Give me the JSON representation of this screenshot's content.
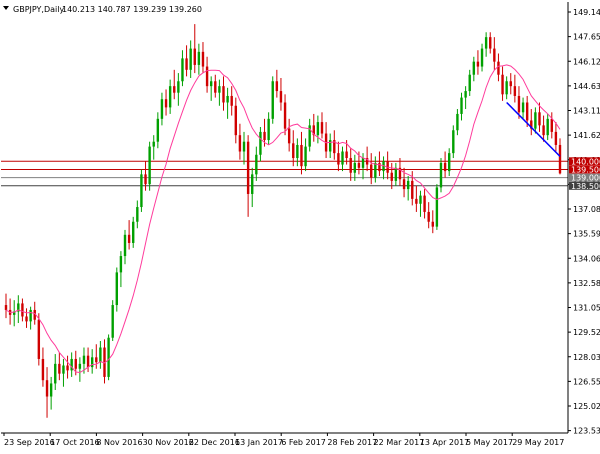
{
  "header": {
    "symbol_label": "GBPJPY,Daily",
    "ohlc_text": "140.213 140.787 139.239 139.260"
  },
  "colors": {
    "bull": "#00a000",
    "bear": "#d00000",
    "ma": "#ff3c9c",
    "trendline": "#0000ff",
    "level_red": "#c00000",
    "level_gray": "#808080",
    "level_dark": "#404040"
  },
  "chart_data": {
    "type": "candlestick",
    "title": "GBPJPY,Daily",
    "xlabel": "",
    "ylabel": "",
    "ylim": [
      124.2,
      149.7
    ],
    "grid": false,
    "y_ticks": [
      "149.140",
      "147.655",
      "146.125",
      "144.630",
      "143.110",
      "141.625",
      "140.095",
      "138.600",
      "137.080",
      "135.595",
      "134.065",
      "132.580",
      "131.050",
      "129.525",
      "128.035",
      "126.550",
      "125.020",
      "123.535"
    ],
    "x_ticks": [
      "23 Sep 2016",
      "17 Oct 2016",
      "8 Nov 2016",
      "30 Nov 2016",
      "22 Dec 2016",
      "13 Jan 2017",
      "6 Feb 2017",
      "28 Feb 2017",
      "22 Mar 2017",
      "13 Apr 2017",
      "5 May 2017",
      "29 May 2017"
    ],
    "levels": [
      {
        "label": "140.000",
        "value": 140.0,
        "color": "level_red"
      },
      {
        "label": "139.500",
        "value": 139.5,
        "color": "level_red"
      },
      {
        "label": "139.000",
        "value": 139.0,
        "color": "level_gray"
      },
      {
        "label": "138.500",
        "value": 138.5,
        "color": "level_dark"
      }
    ],
    "trendline": {
      "from": {
        "bar": 122,
        "price": 143.6
      },
      "to": {
        "bar": 135,
        "price": 140.3
      }
    },
    "ma_period": 10,
    "ohlc": [
      [
        131.2,
        131.9,
        130.4,
        130.9
      ],
      [
        130.9,
        131.6,
        130.0,
        130.6
      ],
      [
        130.6,
        131.5,
        129.9,
        130.8
      ],
      [
        130.8,
        131.8,
        130.1,
        131.3
      ],
      [
        131.3,
        131.6,
        130.2,
        130.5
      ],
      [
        130.5,
        131.0,
        129.8,
        130.2
      ],
      [
        130.2,
        131.1,
        129.7,
        130.9
      ],
      [
        130.9,
        131.4,
        130.0,
        130.3
      ],
      [
        130.3,
        130.7,
        127.5,
        127.9
      ],
      [
        127.9,
        128.6,
        126.2,
        126.6
      ],
      [
        126.6,
        127.4,
        124.3,
        125.6
      ],
      [
        125.6,
        126.8,
        124.8,
        126.4
      ],
      [
        126.4,
        128.2,
        126.0,
        127.6
      ],
      [
        127.6,
        128.3,
        126.6,
        127.0
      ],
      [
        127.0,
        127.9,
        126.2,
        127.5
      ],
      [
        127.5,
        128.1,
        126.7,
        127.2
      ],
      [
        127.2,
        128.3,
        126.8,
        127.9
      ],
      [
        127.9,
        128.4,
        126.9,
        127.3
      ],
      [
        127.3,
        128.0,
        126.5,
        127.6
      ],
      [
        127.6,
        128.6,
        127.0,
        128.1
      ],
      [
        128.1,
        128.6,
        127.1,
        127.4
      ],
      [
        127.4,
        128.5,
        127.0,
        128.0
      ],
      [
        128.0,
        128.8,
        127.3,
        127.7
      ],
      [
        127.7,
        129.0,
        127.3,
        128.6
      ],
      [
        128.6,
        129.1,
        126.4,
        126.8
      ],
      [
        126.8,
        129.4,
        126.6,
        129.2
      ],
      [
        129.2,
        131.5,
        129.0,
        131.2
      ],
      [
        131.2,
        133.5,
        130.8,
        133.2
      ],
      [
        133.2,
        134.5,
        132.3,
        134.2
      ],
      [
        134.2,
        135.8,
        133.7,
        135.5
      ],
      [
        135.5,
        136.4,
        134.6,
        135.0
      ],
      [
        135.0,
        136.6,
        134.7,
        136.3
      ],
      [
        136.3,
        137.6,
        135.9,
        137.2
      ],
      [
        137.2,
        139.5,
        136.9,
        139.2
      ],
      [
        139.2,
        140.0,
        138.2,
        138.6
      ],
      [
        138.6,
        141.2,
        138.2,
        140.9
      ],
      [
        140.9,
        141.6,
        140.1,
        141.2
      ],
      [
        141.2,
        143.0,
        140.8,
        142.6
      ],
      [
        142.6,
        144.2,
        142.2,
        143.8
      ],
      [
        143.8,
        144.4,
        142.8,
        143.3
      ],
      [
        143.3,
        145.0,
        142.9,
        144.6
      ],
      [
        144.6,
        145.6,
        143.8,
        144.2
      ],
      [
        144.2,
        145.4,
        143.4,
        144.9
      ],
      [
        144.9,
        146.8,
        144.6,
        146.3
      ],
      [
        146.3,
        147.1,
        145.2,
        145.6
      ],
      [
        145.6,
        147.4,
        145.1,
        146.9
      ],
      [
        146.9,
        148.4,
        145.4,
        145.9
      ],
      [
        145.9,
        147.2,
        145.3,
        146.7
      ],
      [
        146.7,
        147.3,
        145.4,
        145.8
      ],
      [
        145.8,
        146.4,
        144.2,
        144.6
      ],
      [
        144.6,
        145.2,
        143.7,
        144.9
      ],
      [
        144.9,
        145.3,
        143.9,
        144.2
      ],
      [
        144.2,
        145.0,
        143.4,
        144.6
      ],
      [
        144.6,
        145.2,
        143.1,
        143.6
      ],
      [
        143.6,
        144.5,
        142.6,
        144.0
      ],
      [
        144.0,
        144.6,
        142.8,
        143.4
      ],
      [
        143.4,
        143.9,
        141.1,
        141.6
      ],
      [
        141.6,
        142.3,
        140.1,
        140.6
      ],
      [
        140.6,
        141.8,
        139.8,
        141.2
      ],
      [
        141.2,
        141.6,
        136.6,
        138.0
      ],
      [
        138.0,
        139.6,
        137.2,
        139.2
      ],
      [
        139.2,
        140.9,
        138.8,
        140.4
      ],
      [
        140.4,
        142.1,
        140.0,
        141.8
      ],
      [
        141.8,
        142.6,
        140.9,
        141.3
      ],
      [
        141.3,
        143.0,
        141.0,
        142.6
      ],
      [
        142.6,
        145.2,
        142.3,
        144.9
      ],
      [
        144.9,
        145.6,
        143.9,
        144.3
      ],
      [
        144.3,
        145.1,
        143.1,
        143.6
      ],
      [
        143.6,
        144.1,
        141.6,
        142.0
      ],
      [
        142.0,
        142.6,
        140.6,
        141.1
      ],
      [
        141.1,
        141.9,
        139.7,
        140.2
      ],
      [
        140.2,
        141.4,
        139.7,
        141.0
      ],
      [
        141.0,
        141.8,
        139.2,
        139.7
      ],
      [
        139.7,
        141.4,
        139.4,
        140.9
      ],
      [
        140.9,
        142.6,
        140.6,
        142.2
      ],
      [
        142.2,
        142.9,
        141.2,
        141.6
      ],
      [
        141.6,
        142.8,
        141.1,
        142.4
      ],
      [
        142.4,
        143.0,
        141.4,
        141.7
      ],
      [
        141.7,
        142.4,
        140.2,
        140.6
      ],
      [
        140.6,
        141.7,
        140.2,
        141.3
      ],
      [
        141.3,
        141.9,
        140.1,
        140.5
      ],
      [
        140.5,
        141.2,
        139.4,
        139.8
      ],
      [
        139.8,
        140.9,
        139.4,
        140.6
      ],
      [
        140.6,
        141.3,
        139.8,
        140.2
      ],
      [
        140.2,
        140.8,
        138.8,
        139.3
      ],
      [
        139.3,
        140.4,
        138.8,
        139.9
      ],
      [
        139.9,
        140.6,
        139.2,
        139.6
      ],
      [
        139.6,
        140.5,
        138.9,
        140.2
      ],
      [
        140.2,
        140.9,
        139.4,
        139.8
      ],
      [
        139.8,
        140.5,
        138.6,
        139.0
      ],
      [
        139.0,
        140.3,
        138.7,
        139.9
      ],
      [
        139.9,
        140.6,
        139.1,
        139.4
      ],
      [
        139.4,
        140.3,
        138.9,
        140.0
      ],
      [
        140.0,
        140.6,
        138.9,
        139.3
      ],
      [
        139.3,
        139.9,
        138.3,
        138.8
      ],
      [
        138.8,
        139.9,
        138.5,
        139.6
      ],
      [
        139.6,
        140.2,
        138.5,
        138.9
      ],
      [
        138.9,
        139.6,
        137.8,
        138.3
      ],
      [
        138.3,
        139.1,
        137.6,
        138.8
      ],
      [
        138.8,
        139.4,
        137.3,
        137.7
      ],
      [
        137.7,
        138.5,
        136.9,
        137.4
      ],
      [
        137.4,
        138.2,
        136.6,
        137.9
      ],
      [
        137.9,
        138.3,
        136.5,
        136.9
      ],
      [
        136.9,
        137.5,
        135.9,
        136.3
      ],
      [
        136.3,
        137.0,
        135.6,
        136.0
      ],
      [
        136.0,
        138.6,
        135.8,
        138.4
      ],
      [
        138.4,
        140.2,
        138.1,
        139.9
      ],
      [
        139.9,
        140.6,
        139.0,
        139.4
      ],
      [
        139.4,
        140.8,
        139.1,
        140.5
      ],
      [
        140.5,
        142.2,
        140.2,
        141.9
      ],
      [
        141.9,
        143.2,
        141.6,
        142.9
      ],
      [
        142.9,
        144.2,
        142.5,
        143.9
      ],
      [
        143.9,
        144.6,
        143.2,
        144.3
      ],
      [
        144.3,
        145.6,
        144.0,
        145.3
      ],
      [
        145.3,
        146.4,
        144.9,
        146.1
      ],
      [
        146.1,
        146.8,
        145.3,
        145.8
      ],
      [
        145.8,
        147.2,
        145.5,
        146.9
      ],
      [
        146.9,
        147.9,
        146.4,
        147.6
      ],
      [
        147.6,
        147.9,
        146.6,
        146.9
      ],
      [
        146.9,
        147.6,
        145.6,
        146.1
      ],
      [
        146.1,
        146.6,
        144.9,
        145.3
      ],
      [
        145.3,
        145.8,
        143.7,
        144.1
      ],
      [
        144.1,
        145.2,
        143.8,
        144.9
      ],
      [
        144.9,
        145.4,
        144.1,
        144.6
      ],
      [
        144.6,
        145.3,
        143.6,
        144.0
      ],
      [
        144.0,
        144.6,
        142.6,
        143.0
      ],
      [
        143.0,
        143.9,
        142.6,
        143.6
      ],
      [
        143.6,
        144.0,
        142.1,
        142.5
      ],
      [
        142.5,
        143.2,
        141.6,
        142.0
      ],
      [
        142.0,
        143.3,
        141.7,
        143.0
      ],
      [
        143.0,
        143.6,
        141.8,
        142.2
      ],
      [
        142.2,
        142.8,
        141.2,
        141.6
      ],
      [
        141.6,
        142.9,
        141.3,
        142.6
      ],
      [
        142.6,
        143.0,
        141.4,
        141.8
      ],
      [
        141.8,
        142.4,
        140.6,
        141.0
      ],
      [
        141.0,
        141.4,
        139.2,
        139.26
      ]
    ]
  }
}
